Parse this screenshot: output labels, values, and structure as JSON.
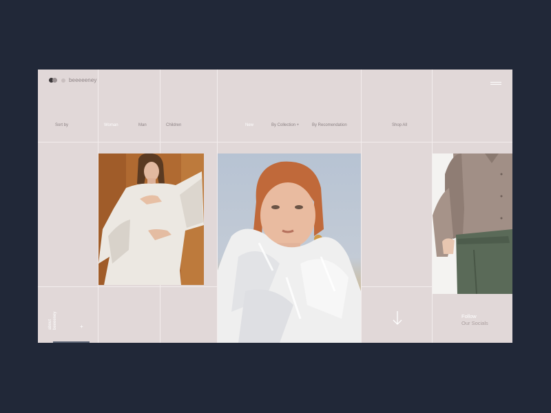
{
  "brand": {
    "name": "beeeeeney"
  },
  "icons": {
    "logo": "three-dots-icon",
    "menu": "hamburger-menu-icon",
    "about_plus": "plus-icon",
    "scroll": "arrow-down-icon"
  },
  "nav": {
    "sort_label": "Sort by",
    "gender": [
      {
        "label": "Woman",
        "active": true
      },
      {
        "label": "Man",
        "active": false
      },
      {
        "label": "Children",
        "active": false
      }
    ],
    "filters": [
      {
        "label": "New",
        "active": true
      },
      {
        "label": "By Collection +",
        "active": false
      },
      {
        "label": "By Recomendation",
        "active": false
      }
    ],
    "shop_all": "Shop All"
  },
  "sidebar": {
    "about": [
      "about",
      "beeeeney"
    ],
    "plus": "+"
  },
  "social": {
    "line1": "Follow",
    "line2": "Our Socials"
  },
  "colors": {
    "page_background": "#212838",
    "panel_background": "#e1d8d8",
    "grid_lines": "#f3eded",
    "active_highlight": "#c5b9ba",
    "muted_text": "#8b8183"
  }
}
